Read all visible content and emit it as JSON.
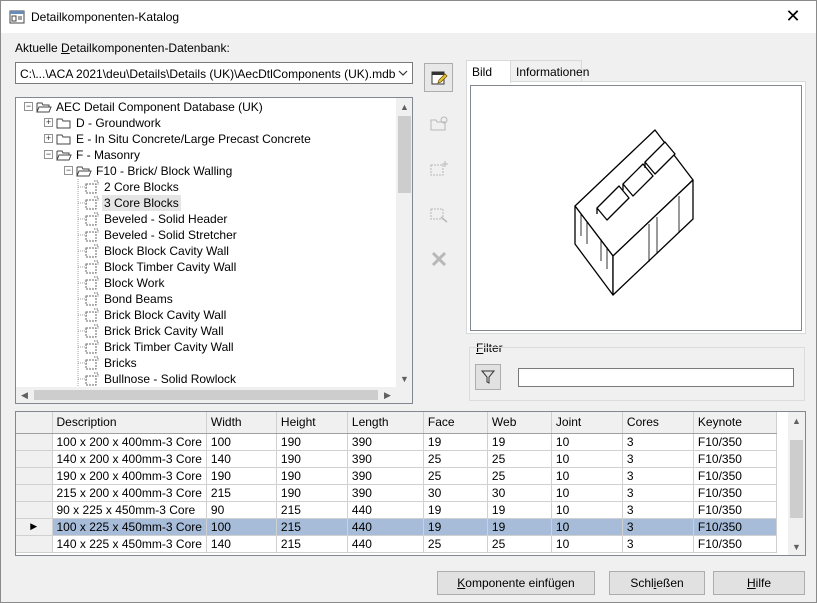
{
  "window": {
    "title": "Detailkomponenten-Katalog"
  },
  "database": {
    "label_prefix": "Aktuelle ",
    "label_hotkey": "D",
    "label_rest": "etailkomponenten-Datenbank:",
    "path": "C:\\...\\ACA 2021\\deu\\Details\\Details (UK)\\AecDtlComponents (UK).mdb"
  },
  "tree": {
    "nodes": [
      {
        "label": "AEC Detail Component Database (UK)",
        "level": 0,
        "expander": "minus",
        "icon": "folder-open-icon"
      },
      {
        "label": "D - Groundwork",
        "level": 1,
        "expander": "plus",
        "icon": "folder-icon"
      },
      {
        "label": "E - In Situ Concrete/Large Precast Concrete",
        "level": 1,
        "expander": "plus",
        "icon": "folder-icon"
      },
      {
        "label": "F - Masonry",
        "level": 1,
        "expander": "minus",
        "icon": "folder-open-icon"
      },
      {
        "label": "F10 - Brick/ Block Walling",
        "level": 2,
        "expander": "minus",
        "icon": "folder-open-icon"
      },
      {
        "label": "2 Core Blocks",
        "level": 3,
        "expander": "",
        "icon": "component-icon"
      },
      {
        "label": "3 Core Blocks",
        "level": 3,
        "expander": "",
        "icon": "component-icon",
        "selected": true
      },
      {
        "label": "Beveled - Solid Header",
        "level": 3,
        "expander": "",
        "icon": "component-icon"
      },
      {
        "label": "Beveled - Solid Stretcher",
        "level": 3,
        "expander": "",
        "icon": "component-icon"
      },
      {
        "label": "Block Block Cavity Wall",
        "level": 3,
        "expander": "",
        "icon": "component-icon"
      },
      {
        "label": "Block Timber Cavity Wall",
        "level": 3,
        "expander": "",
        "icon": "component-icon"
      },
      {
        "label": "Block Work",
        "level": 3,
        "expander": "",
        "icon": "component-icon"
      },
      {
        "label": "Bond Beams",
        "level": 3,
        "expander": "",
        "icon": "component-icon"
      },
      {
        "label": "Brick Block Cavity Wall",
        "level": 3,
        "expander": "",
        "icon": "component-icon"
      },
      {
        "label": "Brick Brick Cavity Wall",
        "level": 3,
        "expander": "",
        "icon": "component-icon"
      },
      {
        "label": "Brick Timber Cavity Wall",
        "level": 3,
        "expander": "",
        "icon": "component-icon"
      },
      {
        "label": "Bricks",
        "level": 3,
        "expander": "",
        "icon": "component-icon"
      },
      {
        "label": "Bullnose - Solid Rowlock",
        "level": 3,
        "expander": "",
        "icon": "component-icon"
      }
    ]
  },
  "tabs": [
    {
      "label": "Bild",
      "active": true
    },
    {
      "label": "Informationen",
      "active": false
    }
  ],
  "filter": {
    "label_hotkey": "F",
    "label_rest": "ilter",
    "value": ""
  },
  "table": {
    "columns": [
      "Description",
      "Width",
      "Height",
      "Length",
      "Face",
      "Web",
      "Joint",
      "Cores",
      "Keynote"
    ],
    "rows": [
      [
        "100 x 200 x 400mm-3 Core",
        "100",
        "190",
        "390",
        "19",
        "19",
        "10",
        "3",
        "F10/350"
      ],
      [
        "140 x 200 x 400mm-3 Core",
        "140",
        "190",
        "390",
        "25",
        "25",
        "10",
        "3",
        "F10/350"
      ],
      [
        "190 x 200 x 400mm-3 Core",
        "190",
        "190",
        "390",
        "25",
        "25",
        "10",
        "3",
        "F10/350"
      ],
      [
        "215 x 200 x 400mm-3 Core",
        "215",
        "190",
        "390",
        "30",
        "30",
        "10",
        "3",
        "F10/350"
      ],
      [
        "90 x 225 x 450mm-3 Core",
        "90",
        "215",
        "440",
        "19",
        "19",
        "10",
        "3",
        "F10/350"
      ],
      [
        "100 x 225 x 450mm-3 Core",
        "100",
        "215",
        "440",
        "19",
        "19",
        "10",
        "3",
        "F10/350"
      ],
      [
        "140 x 225 x 450mm-3 Core",
        "140",
        "215",
        "440",
        "25",
        "25",
        "10",
        "3",
        "F10/350"
      ]
    ],
    "current_row": 5,
    "current_marker": "▶"
  },
  "buttons": {
    "insert": {
      "hotkey": "K",
      "rest": "omponente einfügen"
    },
    "close": {
      "pre": "Schl",
      "hotkey": "i",
      "rest": "eßen"
    },
    "help": {
      "hotkey": "H",
      "rest": "ilfe"
    }
  },
  "colors": {
    "selection": "#a6bcd9",
    "icon_yellow": "#e8c23a"
  }
}
